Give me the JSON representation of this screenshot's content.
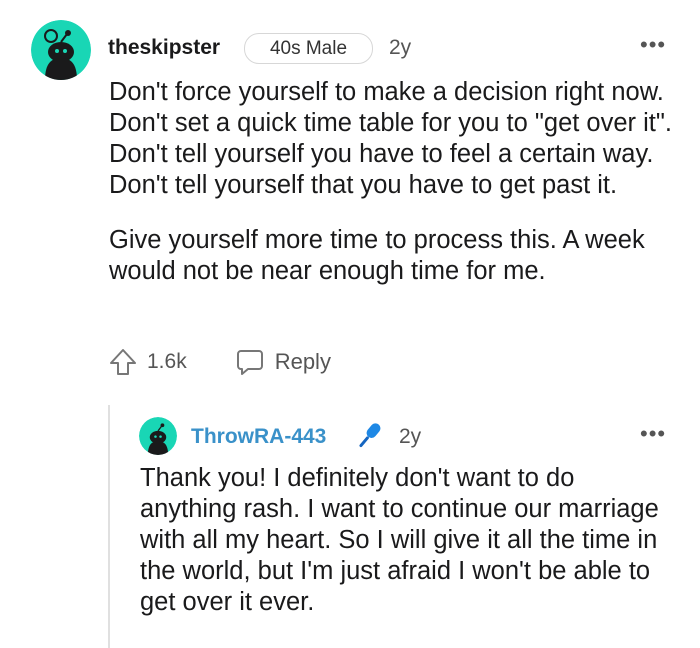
{
  "comment": {
    "username": "theskipster",
    "flair": "40s Male",
    "age": "2y",
    "more_icon": "more-horizontal-icon",
    "paragraphs": [
      "Don't force yourself to make a decision right now. Don't set a quick time table for you to \"get over it\". Don't tell yourself you have to feel a certain way. Don't tell yourself that you have to get past it.",
      "Give yourself more time to process this. A week would not be near enough time for me."
    ],
    "upvote_count": "1.6k",
    "reply_label": "Reply",
    "avatar_color": "#19d6b5"
  },
  "reply": {
    "username": "ThrowRA-443",
    "age": "2y",
    "username_color": "#3a91c9",
    "badge_icon": "microphone-icon",
    "text": "Thank you! I definitely don't want to do anything rash. I want to continue our marriage with all my heart. So I will give it all the time in the world, but I'm just afraid I won't be able to get over it ever.",
    "avatar_color": "#19d6b5"
  }
}
